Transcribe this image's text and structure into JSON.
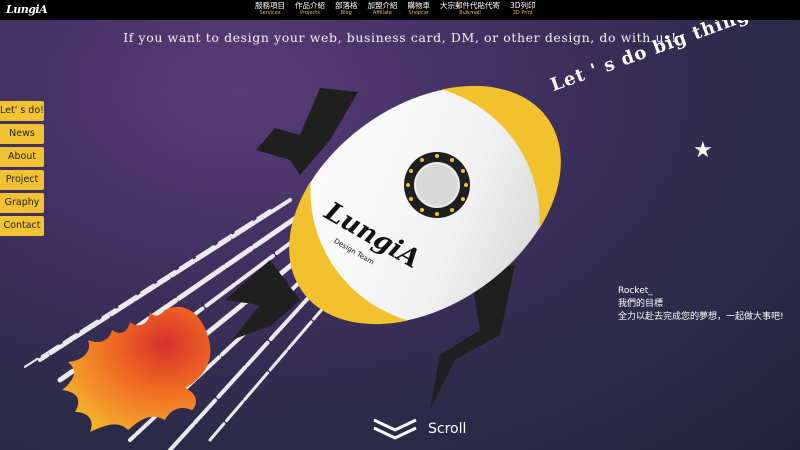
{
  "brand": {
    "logo_text": "LungiA"
  },
  "nav": [
    {
      "zh": "服務項目",
      "en": "Services"
    },
    {
      "zh": "作品介紹",
      "en": "Projects"
    },
    {
      "zh": "部落格",
      "en": "Blog"
    },
    {
      "zh": "加盟介紹",
      "en": "Affiliate"
    },
    {
      "zh": "購物車",
      "en": "Shopcar"
    },
    {
      "zh": "大宗郵件代貼代寄",
      "en": "Bulkmail"
    },
    {
      "zh": "3D列印",
      "en": "3D Print"
    }
  ],
  "hero": {
    "tagline": "If you want to design your web, business card, DM, or other design, do with us!",
    "slogan": "Let ' s do big thing!",
    "star": "★",
    "rocket_logo": "LungiA",
    "rocket_sub": "Design Team"
  },
  "side_menu": [
    "Let' s do!",
    "News",
    "About",
    "Project",
    "Graphy",
    "Contact"
  ],
  "info": {
    "line1": "Rocket_",
    "line2": "我們的目標",
    "line3": "全力以赴去完成您的夢想，一起做大事吧!"
  },
  "scroll": {
    "label": "Scroll"
  },
  "colors": {
    "accent": "#f1c232",
    "nav_bg": "#000000",
    "bg_purple": "#40305f"
  }
}
